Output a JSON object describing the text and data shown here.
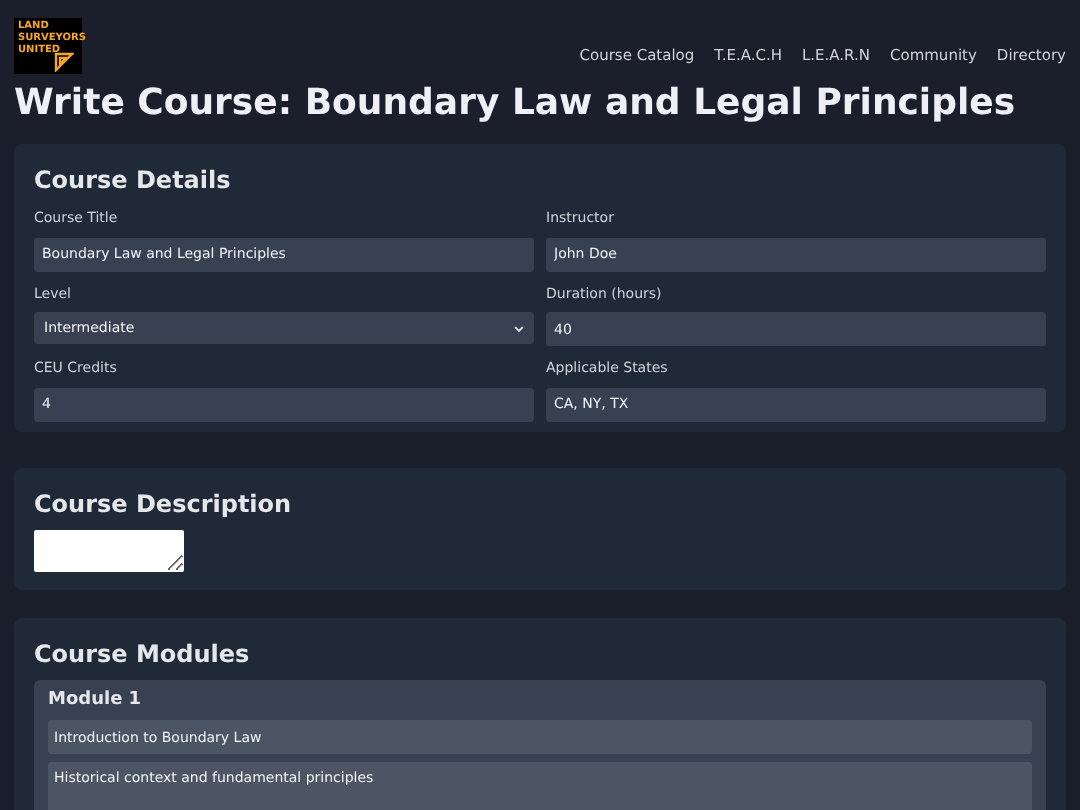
{
  "logo": {
    "lines": [
      "LAND",
      "SURVEYORS",
      "UNITED"
    ]
  },
  "nav": [
    "Course Catalog",
    "T.E.A.C.H",
    "L.E.A.R.N",
    "Community",
    "Directory"
  ],
  "page_title": "Write Course: Boundary Law and Legal Principles",
  "details": {
    "title": "Course Details",
    "fields": [
      {
        "label": "Course Title",
        "value": "Boundary Law and Legal Principles",
        "kind": "text"
      },
      {
        "label": "Instructor",
        "value": "John Doe",
        "kind": "text"
      },
      {
        "label": "Level",
        "value": "Intermediate",
        "kind": "select"
      },
      {
        "label": "Duration (hours)",
        "value": "40",
        "kind": "text"
      },
      {
        "label": "CEU Credits",
        "value": "4",
        "kind": "text"
      },
      {
        "label": "Applicable States",
        "value": "CA, NY, TX",
        "kind": "text"
      }
    ]
  },
  "description": {
    "title": "Course Description"
  },
  "modules": {
    "title": "Course Modules",
    "items": [
      {
        "title": "Module 1",
        "name": "Introduction to Boundary Law",
        "summary": "Historical context and fundamental principles"
      }
    ]
  }
}
